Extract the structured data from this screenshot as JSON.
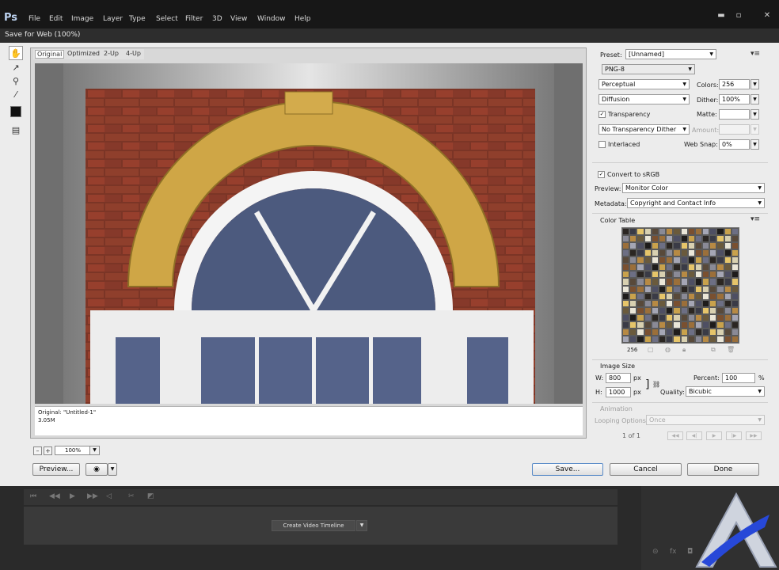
{
  "app": {
    "logo": "Ps",
    "menus": [
      "File",
      "Edit",
      "Image",
      "Layer",
      "Type",
      "Select",
      "Filter",
      "3D",
      "View",
      "Window",
      "Help"
    ],
    "window_controls": {
      "minimize": "▬",
      "maximize": "▫",
      "close": "✕"
    }
  },
  "dialog": {
    "title": "Save for Web (100%)",
    "tabs": [
      "Original",
      "Optimized",
      "2-Up",
      "4-Up"
    ],
    "active_tab": "Original",
    "image_info": {
      "line1": "Original: \"Untitled-1\"",
      "line2": "3.05M"
    },
    "zoom": {
      "value": "100%",
      "zoom_out": "–",
      "zoom_in": "+"
    },
    "buttons": {
      "preview": "Preview...",
      "save": "Save...",
      "cancel": "Cancel",
      "done": "Done"
    }
  },
  "settings": {
    "preset_label": "Preset:",
    "preset_value": "[Unnamed]",
    "format": "PNG-8",
    "reduction": "Perceptual",
    "colors_label": "Colors:",
    "colors_value": "256",
    "dither_algo": "Diffusion",
    "dither_label": "Dither:",
    "dither_value": "100%",
    "transparency_label": "Transparency",
    "transparency_checked": true,
    "matte_label": "Matte:",
    "transparency_dither": "No Transparency Dither",
    "amount_label": "Amount:",
    "interlaced_label": "Interlaced",
    "interlaced_checked": false,
    "web_snap_label": "Web Snap:",
    "web_snap_value": "0%",
    "convert_srgb_label": "Convert to sRGB",
    "convert_srgb_checked": true,
    "preview_label": "Preview:",
    "preview_value": "Monitor Color",
    "metadata_label": "Metadata:",
    "metadata_value": "Copyright and Contact Info"
  },
  "color_table": {
    "title": "Color Table",
    "count": "256",
    "palette": [
      "#2b2622",
      "#6a5a3c",
      "#c9a24c",
      "#8a8a96",
      "#4e4f63",
      "#d8d0b0",
      "#9b6f3a",
      "#3a3b46",
      "#eae6d8",
      "#6d6f84",
      "#b78a44",
      "#1e1c1b",
      "#58493a",
      "#a5a6b4",
      "#e6c56a",
      "#7a5030"
    ]
  },
  "image_size": {
    "title": "Image Size",
    "w_label": "W:",
    "w_value": "800",
    "h_label": "H:",
    "h_value": "1000",
    "unit": "px",
    "percent_label": "Percent:",
    "percent_value": "100",
    "percent_unit": "%",
    "quality_label": "Quality:",
    "quality_value": "Bicubic"
  },
  "animation": {
    "title": "Animation",
    "looping_label": "Looping Options:",
    "looping_value": "Once",
    "frame_info": "1 of 1",
    "controls": [
      "◀◀",
      "◀|",
      "▶",
      "|▶",
      "▶▶"
    ]
  },
  "timeline": {
    "create_button": "Create Video Timeline",
    "arrow": "▼"
  }
}
